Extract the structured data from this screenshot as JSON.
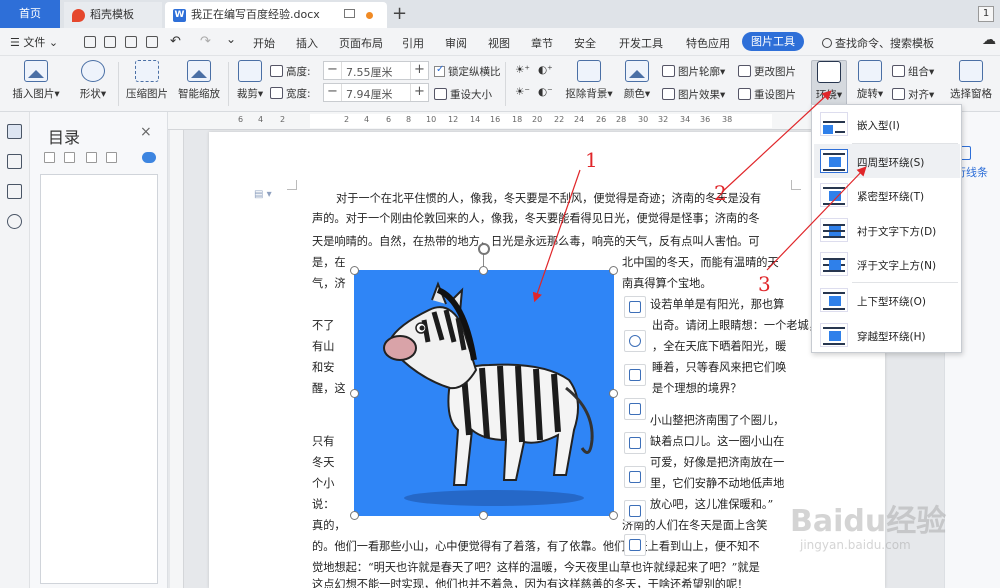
{
  "tabs": {
    "home": "首页",
    "template": "稻壳模板",
    "document": "我正在编写百度经验.docx",
    "new_tab": "+"
  },
  "menu": {
    "file": "文件",
    "items": [
      "开始",
      "插入",
      "页面布局",
      "引用",
      "审阅",
      "视图",
      "章节",
      "安全",
      "开发工具",
      "特色应用"
    ],
    "active": "图片工具",
    "search": "查找命令、搜索模板"
  },
  "ribbon": {
    "insert_picture": "插入图片",
    "shape": "形状",
    "compress": "压缩图片",
    "smart_zoom": "智能缩放",
    "crop": "裁剪",
    "height_label": "高度:",
    "height_value": "7.55厘米",
    "width_label": "宽度:",
    "width_value": "7.94厘米",
    "lock_ratio": "锁定纵横比",
    "reset_size": "重设大小",
    "remove_bg": "抠除背景",
    "color": "颜色",
    "outline": "图片轮廓",
    "effect": "图片效果",
    "change_pic": "更改图片",
    "reset_pic": "重设图片",
    "wrap": "环绕",
    "rotate": "旋转",
    "group": "组合",
    "align": "对齐",
    "selection_pane": "选择窗格"
  },
  "outline_panel": {
    "title": "目录",
    "close": "×"
  },
  "wrap_menu": {
    "items": [
      "嵌入型(I)",
      "四周型环绕(S)",
      "紧密型环绕(T)",
      "衬于文字下方(D)",
      "浮于文字上方(N)",
      "上下型环绕(O)",
      "穿越型环绕(H)"
    ]
  },
  "right_panel": {
    "label": "行线条"
  },
  "document_text": {
    "l1": "对于一个在北平住惯的人，像我，冬天要是不刮风，便觉得是奇迹；济南的冬天是没有",
    "l2": "声的。对于一个刚由伦敦回来的人，像我，冬天要能看得见日光，便觉得是怪事；济南的冬",
    "l3": "天是响晴的。自然，在热带的地方，日光是永远那么毒，响亮的天气，反有点叫人害怕。可",
    "l4a": "是，在",
    "l4b": "北中国的冬天，而能有温晴的天",
    "l5a": "气，济",
    "l5b": "南真得算个宝地。",
    "l6b": "设若单单是有阳光，那也算",
    "l7a": "不了",
    "l7b": "出奇。请闭上眼睛想：一个老城，",
    "l8a": "有山",
    "l8b": "，全在天底下晒着阳光，暖",
    "l9a": "和安",
    "l9b": "睡着，只等春风来把它们唤",
    "l10a": "醒，这",
    "l10b": "是个理想的境界？",
    "l11b": "小山整把济南围了个圈儿，",
    "l12a": "只有",
    "l12b": "缺着点口儿。这一圈小山在",
    "l13a": "冬天",
    "l13b": "可爱，好像是把济南放在一",
    "l14a": "个小",
    "l14b": "里，它们安静不动地低声地",
    "l15a": "说：",
    "l15b": "放心吧，这儿准保暖和。”",
    "l16a": "真的，",
    "l16b": "济南的人们在冬天是面上含笑",
    "l17": "的。他们一看那些小山，心中便觉得有了着落，有了依靠。他们由天上看到山上，便不知不",
    "l18": "觉地想起：“明天也许就是春天了吧？这样的温暖，今天夜里山草也许就绿起来了吧？”就是",
    "l19": "这点幻想不能一时实现，他们也并不着急，因为有这样慈善的冬天，干啥还希望别的呢！"
  },
  "annotations": [
    "1",
    "2",
    "3"
  ],
  "watermark": {
    "main": "Baidu经验",
    "sub": "jingyan.baidu.com"
  },
  "colors": {
    "accent": "#2e6fd8",
    "image_bg": "#2f85f6",
    "annotation": "#e0262a"
  }
}
